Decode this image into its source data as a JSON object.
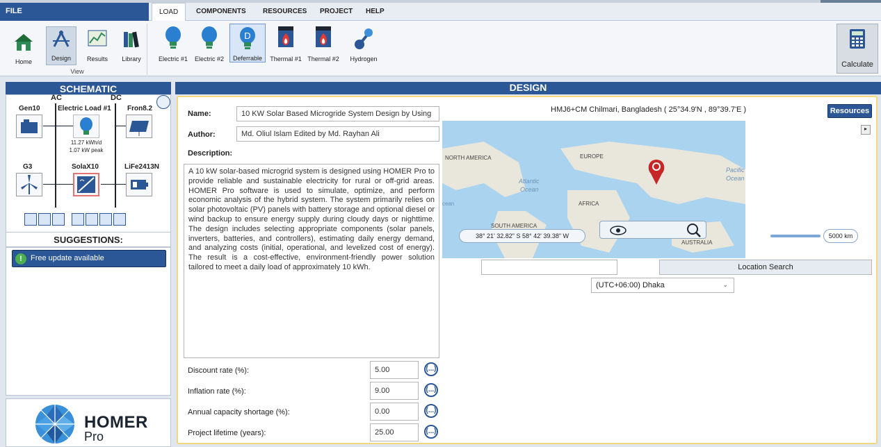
{
  "menu": {
    "file": "FILE",
    "tabs": [
      "LOAD",
      "COMPONENTS",
      "RESOURCES",
      "PROJECT",
      "HELP"
    ]
  },
  "ribbon": {
    "view_buttons": [
      "Home",
      "Design",
      "Results",
      "Library"
    ],
    "view_group_label": "View",
    "load_buttons": [
      "Electric #1",
      "Electric #2",
      "Deferrable",
      "Thermal #1",
      "Thermal #2",
      "Hydrogen"
    ],
    "deferrable_glyph": "D",
    "calculate": "Calculate"
  },
  "schematic": {
    "title": "SCHEMATIC",
    "bus_ac": "AC",
    "bus_dc": "DC",
    "gen": "Gen10",
    "load": "Electric Load #1",
    "pv": "Fron8.2",
    "load_kwh": "11.27 kWh/d",
    "load_peak": "1.07 kW peak",
    "wind": "G3",
    "converter": "SolaX10",
    "battery": "LiFe2413N"
  },
  "suggestions": {
    "title": "SUGGESTIONS:",
    "item": "Free update available"
  },
  "logo": {
    "name": "HOMER",
    "sub": "Pro"
  },
  "design": {
    "title": "DESIGN",
    "name_label": "Name:",
    "name_value": "10 KW Solar Based Microgride System Design by Using",
    "author_label": "Author:",
    "author_value": "Md. Oliul Islam Edited by Md. Rayhan Ali",
    "description_label": "Description:",
    "description": "A 10 kW solar-based microgrid system is designed using HOMER Pro to provide reliable and sustainable electricity for rural or off-grid areas. HOMER Pro software is used to simulate, optimize, and perform economic analysis of the hybrid system. The system primarily relies on solar photovoltaic (PV) panels with battery storage and optional diesel or wind backup to ensure energy supply during cloudy days or nighttime. The design includes selecting appropriate components (solar panels, inverters, batteries, and controllers), estimating daily energy demand, and analyzing costs (initial, operational, and levelized cost of energy). The result is a cost-effective, environment-friendly power solution tailored to meet a daily load of approximately 10 kWh.",
    "econ": [
      {
        "label": "Discount rate (%):",
        "value": "5.00"
      },
      {
        "label": "Inflation rate (%):",
        "value": "9.00"
      },
      {
        "label": "Annual capacity shortage (%):",
        "value": "0.00"
      },
      {
        "label": "Project lifetime (years):",
        "value": "25.00"
      }
    ],
    "econ_btn": "(...)"
  },
  "location": {
    "title": "HMJ6+CM Chilmari, Bangladesh ( 25°34.9'N , 89°39.7'E )",
    "resources_btn": "Resources",
    "coords": "38° 21' 32.82\" S 58° 42' 39.38\" W",
    "scale": "5000 km",
    "search_value": "",
    "search_btn": "Location Search",
    "timezone": "(UTC+06:00) Dhaka",
    "map_labels": {
      "na": "NORTH AMERICA",
      "eu": "EUROPE",
      "atl1": "Atlantic",
      "atl2": "Ocean",
      "af": "AFRICA",
      "sa": "SOUTH AMERICA",
      "au": "AUSTRALIA",
      "pac1": "Pacific",
      "pac2": "Ocean",
      "ocean_left": "cean"
    }
  }
}
